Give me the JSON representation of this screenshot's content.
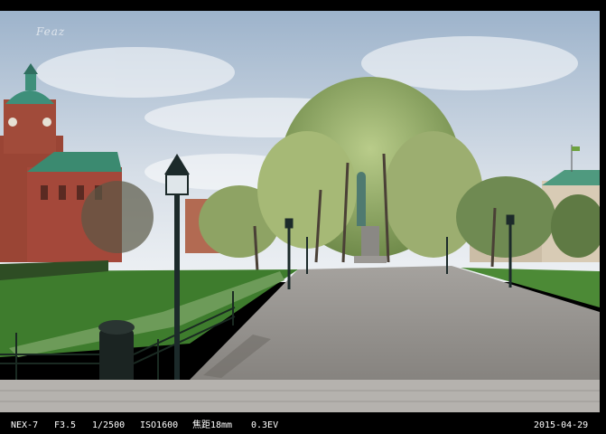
{
  "watermark_text": "Feaz",
  "exif": {
    "camera": "NEX-7",
    "aperture": "F3.5",
    "shutter": "1/2500",
    "iso": "ISO1600",
    "focal": "焦距18mm",
    "exposure": "0.3EV",
    "date": "2015-04-29"
  },
  "colors": {
    "sky_top": "#9fb4cc",
    "sky_bottom": "#e9eef3",
    "grass": "#3f7a2f",
    "path": "#8f8c88",
    "building_red": "#a94a3a",
    "roof_green": "#3f8a72",
    "frame": "#000000"
  }
}
